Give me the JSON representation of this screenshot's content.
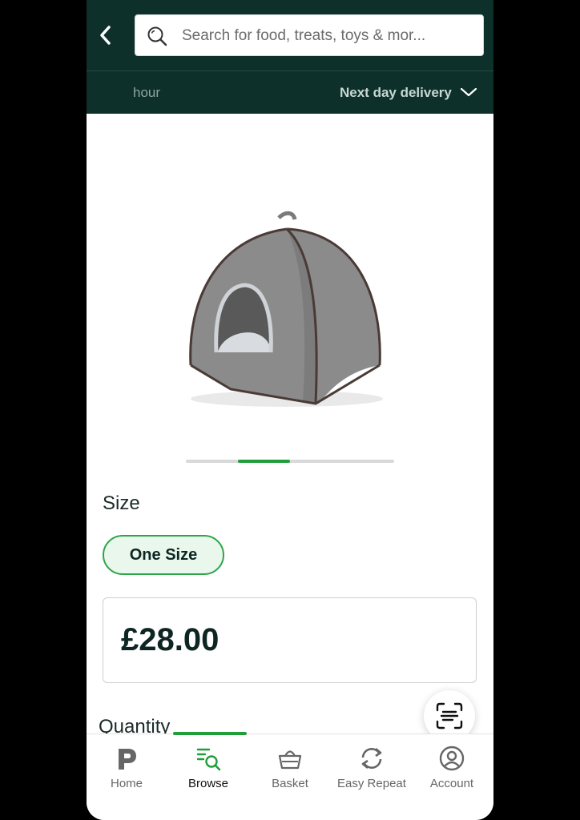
{
  "search": {
    "placeholder": "Search for food, treats, toys & mor..."
  },
  "delivery": {
    "left_label": "hour",
    "right_label": "Next day delivery"
  },
  "product": {
    "image_icon": "pet-igloo-bed-image"
  },
  "carousel": {
    "total": 4,
    "active_index": 1
  },
  "size": {
    "label": "Size",
    "selected": "One Size"
  },
  "price": {
    "value": "£28.00"
  },
  "quantity": {
    "label": "Quantity"
  },
  "nav": {
    "items": [
      {
        "label": "Home",
        "icon": "home-p-icon"
      },
      {
        "label": "Browse",
        "icon": "browse-icon"
      },
      {
        "label": "Basket",
        "icon": "basket-icon"
      },
      {
        "label": "Easy Repeat",
        "icon": "repeat-icon"
      },
      {
        "label": "Account",
        "icon": "account-icon"
      }
    ],
    "active": "Browse"
  },
  "colors": {
    "header": "#0d312a",
    "accent_green": "#1f9e3a",
    "text_dark": "#0d2622"
  }
}
